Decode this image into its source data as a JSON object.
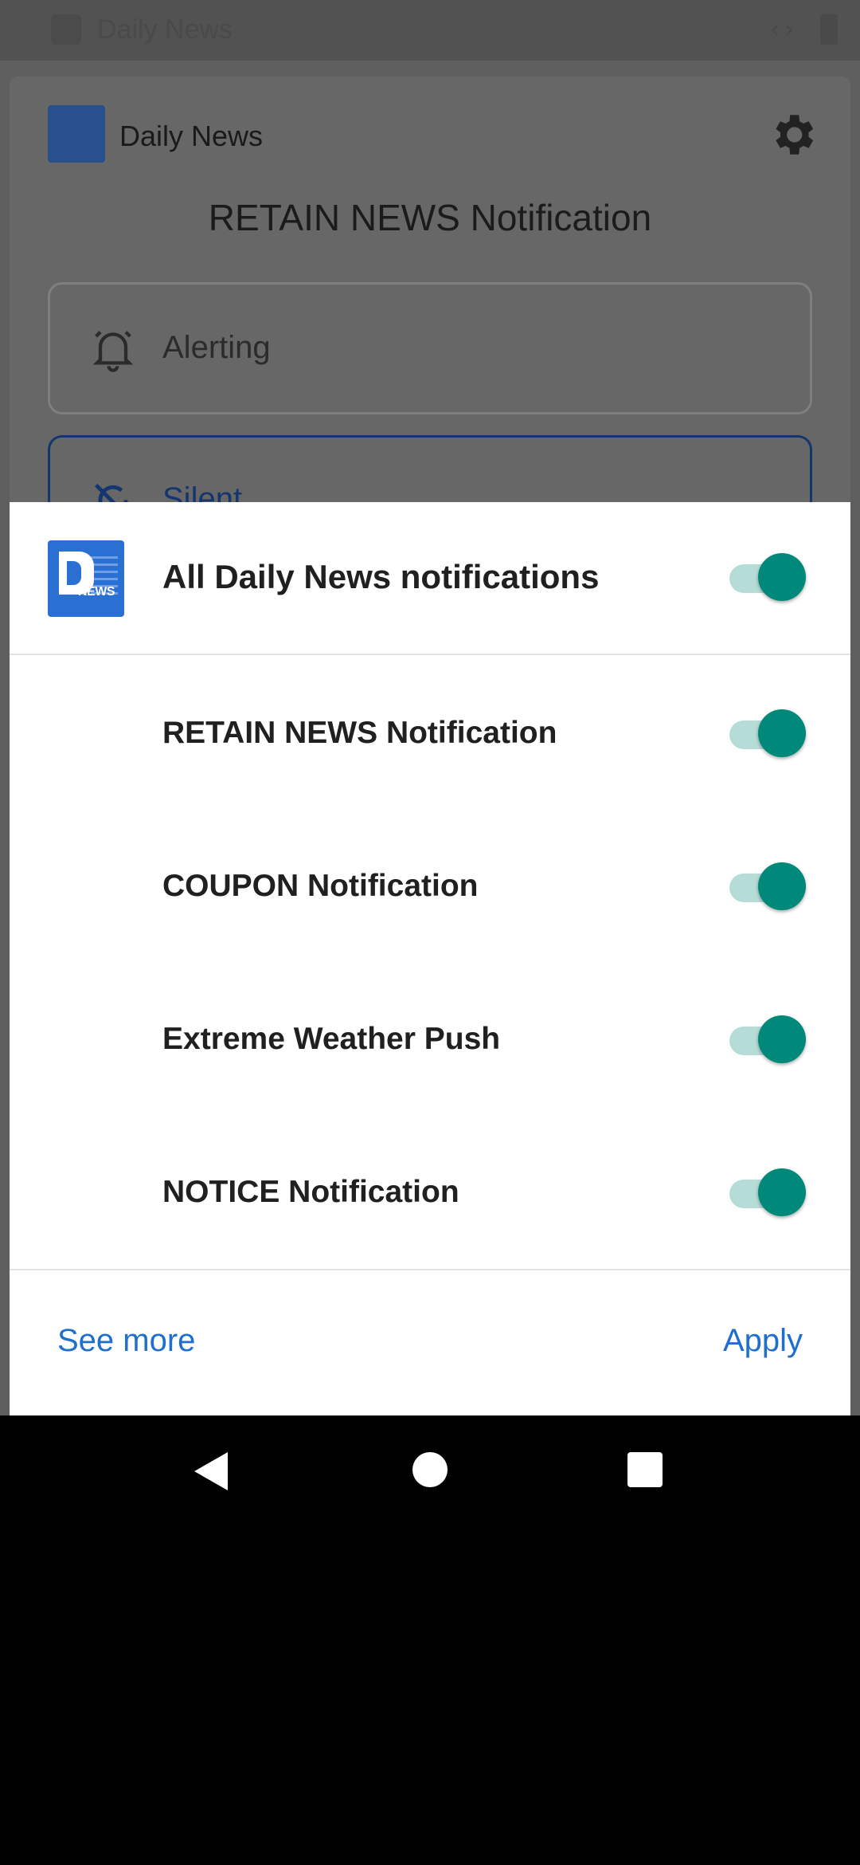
{
  "status_bar": {
    "app_title": "Daily News",
    "code_icon": "‹›"
  },
  "background": {
    "app_name": "Daily News",
    "heading": "RETAIN NEWS Notification",
    "options": [
      {
        "label": "Alerting",
        "icon": "bell-icon"
      },
      {
        "label": "Silent",
        "icon": "bell-off-icon"
      }
    ]
  },
  "dialog": {
    "logo_tag": "NEWS",
    "master": {
      "label": "All Daily News notifications",
      "enabled": true
    },
    "channels": [
      {
        "label": "RETAIN NEWS Notification",
        "enabled": true
      },
      {
        "label": "COUPON Notification",
        "enabled": true
      },
      {
        "label": "Extreme Weather Push",
        "enabled": true
      },
      {
        "label": "NOTICE Notification",
        "enabled": true
      }
    ],
    "see_more": "See more",
    "apply": "Apply"
  },
  "colors": {
    "accent": "#00897b",
    "link": "#1f6fce",
    "app_icon": "#2a6fd2"
  }
}
